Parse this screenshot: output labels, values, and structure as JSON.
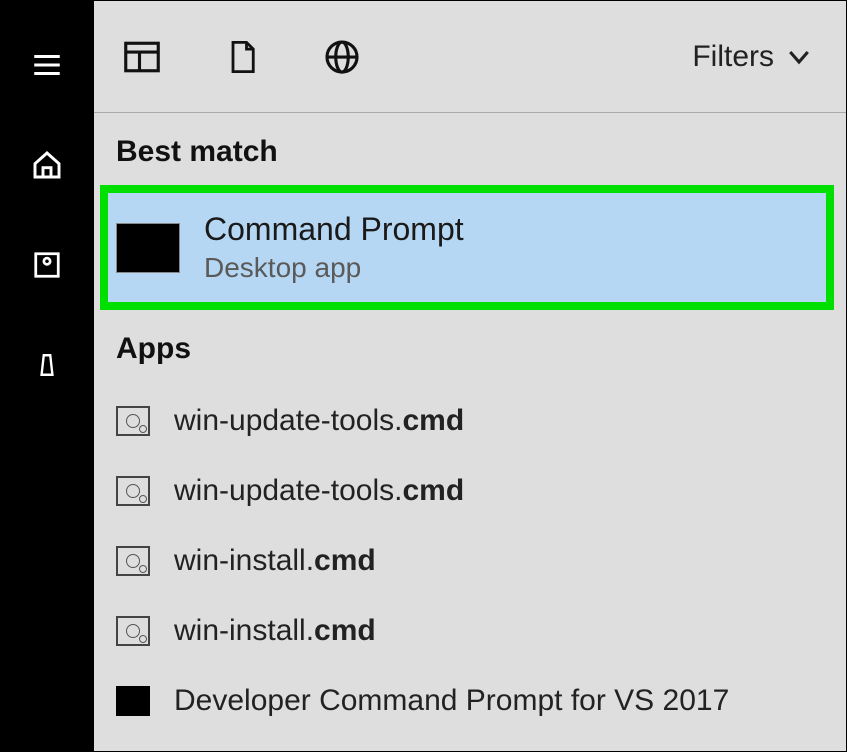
{
  "sidebar": {
    "items": [
      {
        "name": "hamburger-icon"
      },
      {
        "name": "home-icon"
      },
      {
        "name": "photo-icon"
      },
      {
        "name": "remote-icon"
      }
    ]
  },
  "toolbar": {
    "icons": [
      {
        "name": "apps-window-icon"
      },
      {
        "name": "document-icon"
      },
      {
        "name": "web-icon"
      }
    ],
    "filters_label": "Filters"
  },
  "sections": {
    "best_match_heading": "Best match",
    "apps_heading": "Apps"
  },
  "best_match": {
    "title": "Command Prompt",
    "subtitle": "Desktop app",
    "icon": "command-prompt-icon",
    "highlight_color": "#00E000",
    "selected_bg": "#b6d7f3"
  },
  "apps": [
    {
      "prefix": "win-update-tools.",
      "bold": "cmd",
      "icon": "cmd-file-icon"
    },
    {
      "prefix": "win-update-tools.",
      "bold": "cmd",
      "icon": "cmd-file-icon"
    },
    {
      "prefix": "win-install.",
      "bold": "cmd",
      "icon": "cmd-file-icon"
    },
    {
      "prefix": "win-install.",
      "bold": "cmd",
      "icon": "cmd-file-icon"
    },
    {
      "prefix": "Developer Command Prompt for VS 2017",
      "bold": "",
      "icon": "dev-cmd-icon"
    }
  ]
}
